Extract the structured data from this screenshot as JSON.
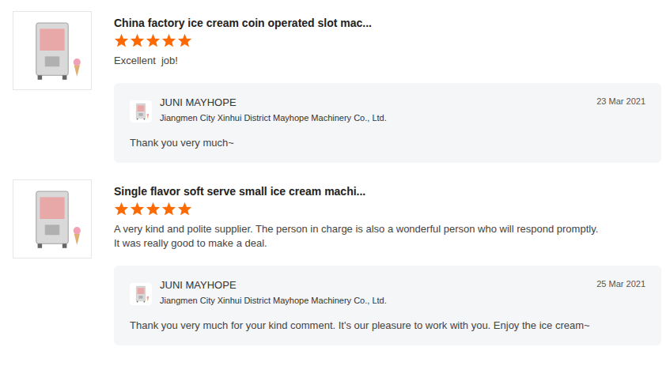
{
  "reviews": [
    {
      "product_title": "China factory ice cream coin operated slot mac...",
      "stars": 5,
      "lines": [
        "Excellent  job!"
      ],
      "reply": {
        "name": "JUNI MAYHOPE",
        "company": "Jiangmen City Xinhui District Mayhope Machinery Co., Ltd.",
        "date": "23 Mar 2021",
        "text": "Thank you very much~"
      }
    },
    {
      "product_title": "Single flavor soft serve small ice cream machi...",
      "stars": 5,
      "lines": [
        "A very kind and polite supplier. The person in charge is also a wonderful person who will respond promptly.",
        "It was really good to make a deal."
      ],
      "reply": {
        "name": "JUNI MAYHOPE",
        "company": "Jiangmen City Xinhui District Mayhope Machinery Co., Ltd.",
        "date": "25 Mar 2021",
        "text": "Thank you very much for your kind comment. It's our pleasure to work with you. Enjoy the ice cream~"
      }
    }
  ]
}
